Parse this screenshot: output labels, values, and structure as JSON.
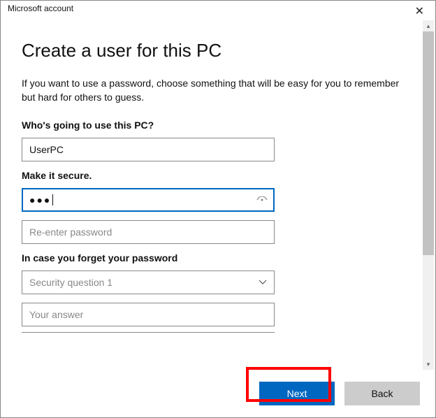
{
  "window": {
    "title": "Microsoft account"
  },
  "page": {
    "heading": "Create a user for this PC",
    "subtitle": "If you want to use a password, choose something that will be easy for you to remember but hard for others to guess."
  },
  "sections": {
    "user_label": "Who's going to use this PC?",
    "secure_label": "Make it secure.",
    "forget_label": "In case you forget your password"
  },
  "fields": {
    "username_value": "UserPC",
    "password_masked": "●●●",
    "reenter_placeholder": "Re-enter password",
    "security_q1_placeholder": "Security question 1",
    "answer_placeholder": "Your answer"
  },
  "buttons": {
    "next": "Next",
    "back": "Back"
  },
  "colors": {
    "accent": "#0067c0",
    "highlight": "#ff0000"
  }
}
